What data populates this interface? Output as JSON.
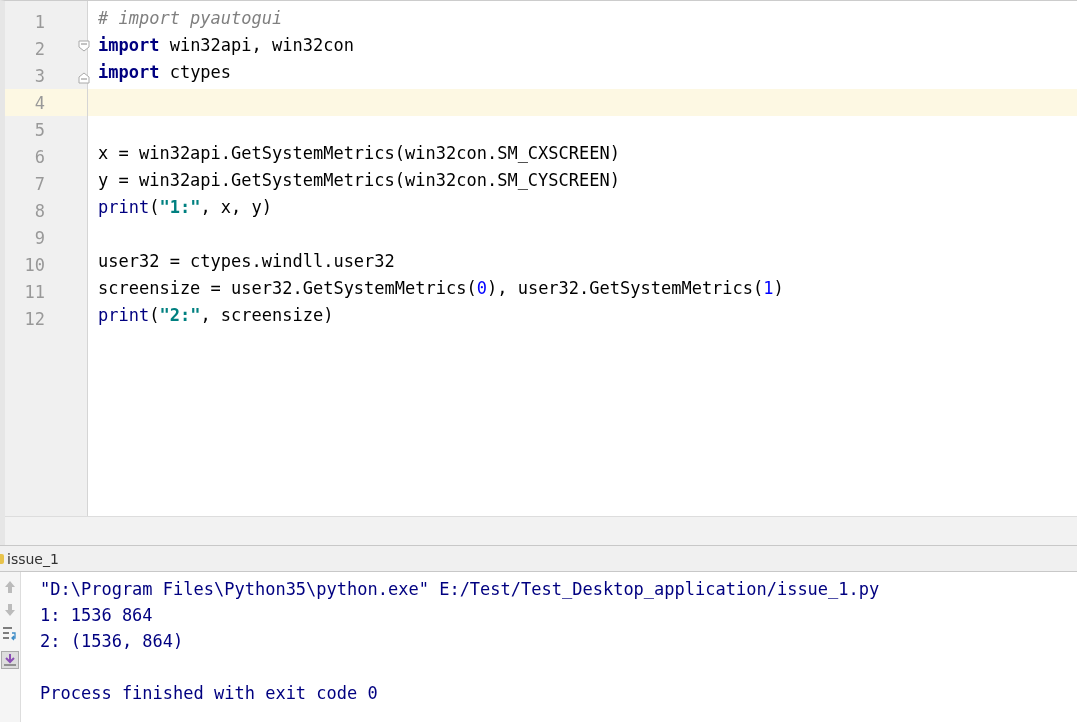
{
  "editor": {
    "lines": [
      {
        "number": "1",
        "current": false,
        "tokens": [
          {
            "kind": "comment",
            "text": "# import pyautogui"
          }
        ]
      },
      {
        "number": "2",
        "current": false,
        "fold": {
          "kind": "start"
        },
        "tokens": [
          {
            "kind": "keyword",
            "text": "import"
          },
          {
            "kind": "plain",
            "text": " win32api, win32con"
          }
        ]
      },
      {
        "number": "3",
        "current": false,
        "fold": {
          "kind": "end"
        },
        "tokens": [
          {
            "kind": "keyword",
            "text": "import"
          },
          {
            "kind": "plain",
            "text": " ctypes"
          }
        ]
      },
      {
        "number": "4",
        "current": true
      },
      {
        "number": "5",
        "current": false
      },
      {
        "number": "6",
        "current": false,
        "tokens": [
          {
            "kind": "plain",
            "text": "x = win32api.GetSystemMetrics(win32con.SM_CXSCREEN)"
          }
        ]
      },
      {
        "number": "7",
        "current": false,
        "tokens": [
          {
            "kind": "plain",
            "text": "y = win32api.GetSystemMetrics(win32con.SM_CYSCREEN)"
          }
        ]
      },
      {
        "number": "8",
        "current": false,
        "tokens": [
          {
            "kind": "builtin",
            "text": "print"
          },
          {
            "kind": "plain",
            "text": "("
          },
          {
            "kind": "string",
            "text": "\"1:\""
          },
          {
            "kind": "plain",
            "text": ", x, y)"
          }
        ]
      },
      {
        "number": "9",
        "current": false
      },
      {
        "number": "10",
        "current": false,
        "tokens": [
          {
            "kind": "plain",
            "text": "user32 = ctypes.windll.user32"
          }
        ]
      },
      {
        "number": "11",
        "current": false,
        "tokens": [
          {
            "kind": "plain",
            "text": "screensize = user32.GetSystemMetrics("
          },
          {
            "kind": "number",
            "text": "0"
          },
          {
            "kind": "plain",
            "text": "), user32.GetSystemMetrics("
          },
          {
            "kind": "number",
            "text": "1"
          },
          {
            "kind": "plain",
            "text": ")"
          }
        ]
      },
      {
        "number": "12",
        "current": false,
        "tokens": [
          {
            "kind": "builtin",
            "text": "print"
          },
          {
            "kind": "plain",
            "text": "("
          },
          {
            "kind": "string",
            "text": "\"2:\""
          },
          {
            "kind": "plain",
            "text": ", screensize)"
          }
        ]
      }
    ]
  },
  "run_panel": {
    "title": "issue_1",
    "output": [
      {
        "kind": "command",
        "text": "\"D:\\Program Files\\Python35\\python.exe\" E:/Test/Test_Desktop_application/issue_1.py"
      },
      {
        "kind": "stdout",
        "text": "1: 1536 864"
      },
      {
        "kind": "stdout",
        "text": "2: (1536, 864)"
      },
      {
        "kind": "exit",
        "text": "Process finished with exit code 0"
      }
    ]
  }
}
